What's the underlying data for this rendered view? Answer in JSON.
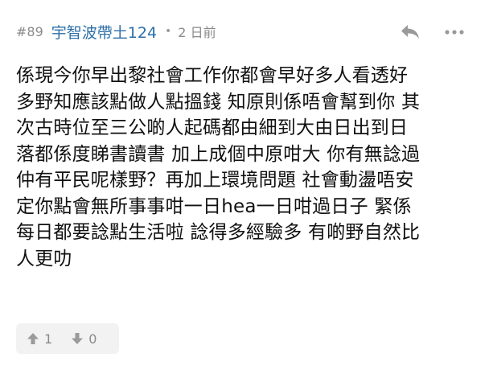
{
  "post": {
    "floor": "#89",
    "username": "宇智波帶土124",
    "separator": "•",
    "time": "2 日前",
    "content_lines": [
      "係現今你早出黎社會工作你都會早好多人看透好",
      "多野知應該點做人點搵錢 知原則係唔會幫到你 其",
      "次古時位至三公啲人起碼都由細到大由日出到日",
      "落都係度睇書讀書 加上成個中原咁大 你有無諗過",
      "仲有平民呢樣野？再加上環境問題 社會動盪唔安",
      "定你點會無所事事咁一日hea一日咁過日子 緊係",
      "每日都要諗點生活啦 諗得多經驗多 有啲野自然比",
      "人更叻"
    ],
    "upvotes": "1",
    "downvotes": "0"
  },
  "icons": {
    "reply": "reply-icon",
    "more": "more-options-icon",
    "upvote": "thumbs-up-icon",
    "downvote": "thumbs-down-icon"
  },
  "colors": {
    "username": "#2c6fa8",
    "meta": "#8a8a8a",
    "text": "#111111",
    "vote_bg": "#f2f2f2"
  }
}
